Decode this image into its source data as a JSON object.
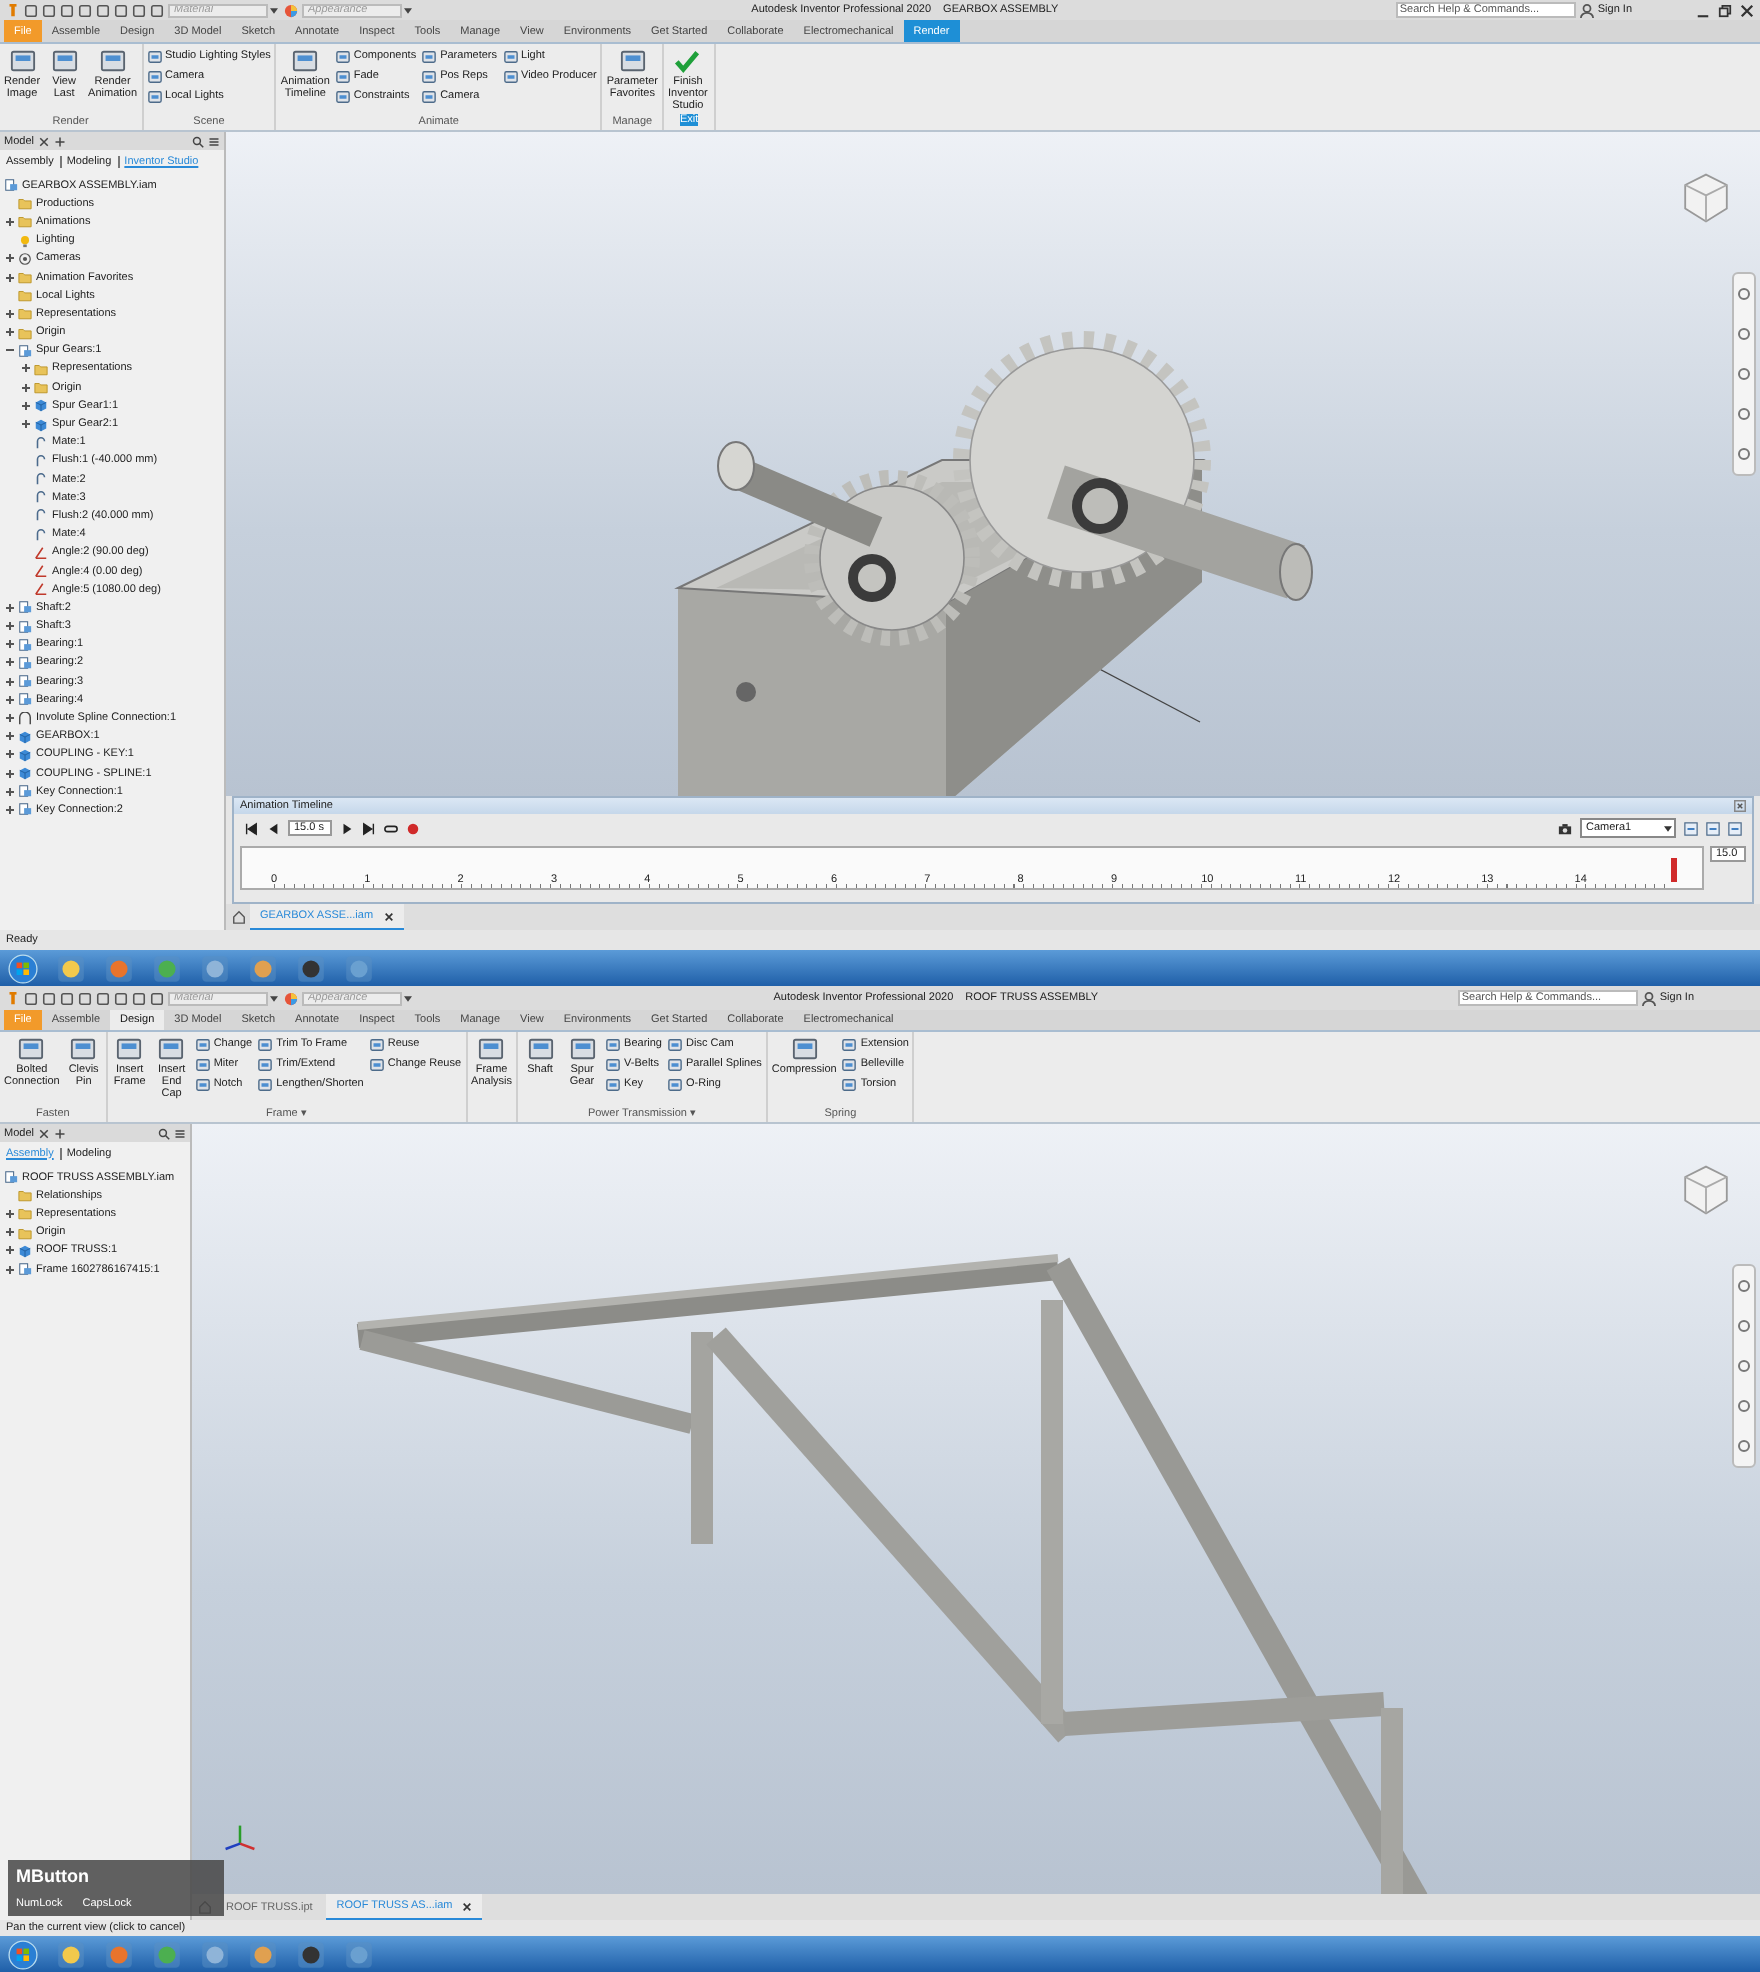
{
  "windows": [
    {
      "title": "Autodesk Inventor Professional 2020",
      "document": "GEARBOX ASSEMBLY",
      "material": {
        "placeholder": "Material"
      },
      "appearance": {
        "placeholder": "Appearance"
      },
      "search": {
        "placeholder": "Search Help & Commands..."
      },
      "sign_in": "Sign In",
      "window_controls": true,
      "tabs": [
        {
          "label": "File",
          "kind": "file",
          "selected": false
        },
        {
          "label": "Assemble",
          "kind": "tab",
          "selected": false
        },
        {
          "label": "Design",
          "kind": "tab",
          "selected": false
        },
        {
          "label": "3D Model",
          "kind": "tab",
          "selected": false
        },
        {
          "label": "Sketch",
          "kind": "tab",
          "selected": false
        },
        {
          "label": "Annotate",
          "kind": "tab",
          "selected": false
        },
        {
          "label": "Inspect",
          "kind": "tab",
          "selected": false
        },
        {
          "label": "Tools",
          "kind": "tab",
          "selected": false
        },
        {
          "label": "Manage",
          "kind": "tab",
          "selected": false
        },
        {
          "label": "View",
          "kind": "tab",
          "selected": false
        },
        {
          "label": "Environments",
          "kind": "tab",
          "selected": false
        },
        {
          "label": "Get Started",
          "kind": "tab",
          "selected": false
        },
        {
          "label": "Collaborate",
          "kind": "tab",
          "selected": false
        },
        {
          "label": "Electromechanical",
          "kind": "tab",
          "selected": false
        },
        {
          "label": "Render",
          "kind": "environment",
          "selected": true
        }
      ],
      "ribbon": [
        {
          "label": "Render",
          "items": [
            {
              "kind": "large",
              "label": "Render Image"
            },
            {
              "kind": "large",
              "label": "View Last"
            },
            {
              "kind": "large",
              "label": "Render Animation"
            }
          ]
        },
        {
          "label": "Scene",
          "items": [
            {
              "kind": "column",
              "items": [
                "Studio Lighting Styles",
                "Camera",
                "Local Lights"
              ]
            }
          ]
        },
        {
          "label": "Animate",
          "items": [
            {
              "kind": "large",
              "label": "Animation Timeline"
            },
            {
              "kind": "column",
              "items": [
                "Components",
                "Fade",
                "Constraints"
              ]
            },
            {
              "kind": "column",
              "items": [
                "Parameters",
                "Pos Reps",
                "Camera"
              ]
            },
            {
              "kind": "column",
              "items": [
                "Light",
                "Video Producer"
              ]
            }
          ]
        },
        {
          "label": "Manage",
          "items": [
            {
              "kind": "large",
              "label": "Parameter Favorites"
            }
          ]
        },
        {
          "label": "Exit",
          "accent": true,
          "items": [
            {
              "kind": "confirm",
              "label": "Finish Inventor Studio"
            }
          ]
        }
      ],
      "browser": {
        "title": "Model",
        "modes": [
          {
            "label": "Assembly",
            "selected": false
          },
          {
            "label": "Modeling",
            "selected": false
          },
          {
            "label": "Inventor Studio",
            "selected": true
          }
        ],
        "tree": [
          {
            "label": "GEARBOX ASSEMBLY.iam",
            "kind": "assembly",
            "children": [
              {
                "label": "Productions",
                "kind": "folder"
              },
              {
                "label": "Animations",
                "kind": "folder",
                "expanded": false
              },
              {
                "label": "Lighting",
                "kind": "light"
              },
              {
                "label": "Cameras",
                "kind": "camera",
                "expanded": false
              },
              {
                "label": "Animation Favorites",
                "kind": "folder",
                "expanded": false
              },
              {
                "label": "Local Lights",
                "kind": "folder"
              },
              {
                "label": "Representations",
                "kind": "folder",
                "expanded": false
              },
              {
                "label": "Origin",
                "kind": "folder",
                "expanded": false
              },
              {
                "label": "Spur Gears:1",
                "kind": "assembly",
                "expanded": true,
                "children": [
                  {
                    "label": "Representations",
                    "kind": "folder",
                    "expanded": false
                  },
                  {
                    "label": "Origin",
                    "kind": "folder",
                    "expanded": false
                  },
                  {
                    "label": "Spur Gear1:1",
                    "kind": "part",
                    "expanded": false
                  },
                  {
                    "label": "Spur Gear2:1",
                    "kind": "part",
                    "expanded": false
                  },
                  {
                    "label": "Mate:1",
                    "kind": "constraint"
                  },
                  {
                    "label": "Flush:1 (-40.000 mm)",
                    "kind": "constraint"
                  },
                  {
                    "label": "Mate:2",
                    "kind": "constraint"
                  },
                  {
                    "label": "Mate:3",
                    "kind": "constraint"
                  },
                  {
                    "label": "Flush:2 (40.000 mm)",
                    "kind": "constraint"
                  },
                  {
                    "label": "Mate:4",
                    "kind": "constraint"
                  },
                  {
                    "label": "Angle:2 (90.00 deg)",
                    "kind": "angle"
                  },
                  {
                    "label": "Angle:4 (0.00 deg)",
                    "kind": "angle"
                  },
                  {
                    "label": "Angle:5 (1080.00 deg)",
                    "kind": "angle"
                  }
                ]
              },
              {
                "label": "Shaft:2",
                "kind": "assembly",
                "expanded": false
              },
              {
                "label": "Shaft:3",
                "kind": "assembly",
                "expanded": false
              },
              {
                "label": "Bearing:1",
                "kind": "assembly",
                "expanded": false
              },
              {
                "label": "Bearing:2",
                "kind": "assembly",
                "expanded": false
              },
              {
                "label": "Bearing:3",
                "kind": "assembly",
                "expanded": false
              },
              {
                "label": "Bearing:4",
                "kind": "assembly",
                "expanded": false
              },
              {
                "label": "Involute Spline Connection:1",
                "kind": "spline",
                "expanded": false
              },
              {
                "label": "GEARBOX:1",
                "kind": "part",
                "expanded": false
              },
              {
                "label": "COUPLING - KEY:1",
                "kind": "part",
                "expanded": false
              },
              {
                "label": "COUPLING - SPLINE:1",
                "kind": "part",
                "expanded": false
              },
              {
                "label": "Key Connection:1",
                "kind": "assembly",
                "expanded": false
              },
              {
                "label": "Key Connection:2",
                "kind": "assembly",
                "expanded": false
              }
            ]
          }
        ]
      },
      "viewport": {
        "kind": "gearbox"
      },
      "timeline": {
        "title": "Animation Timeline",
        "time": "15.0 s",
        "camera": "Camera1",
        "end": "15.0",
        "ticks": [
          "0",
          "1",
          "2",
          "3",
          "4",
          "5",
          "6",
          "7",
          "8",
          "9",
          "10",
          "11",
          "12",
          "13",
          "14"
        ],
        "level": 1
      },
      "documents": [
        {
          "label": "GEARBOX ASSE...iam",
          "selected": true
        }
      ],
      "status": "Ready"
    },
    {
      "title": "Autodesk Inventor Professional 2020",
      "document": "ROOF TRUSS ASSEMBLY",
      "material": {
        "placeholder": "Material"
      },
      "appearance": {
        "placeholder": "Appearance"
      },
      "search": {
        "placeholder": "Search Help & Commands..."
      },
      "sign_in": "Sign In",
      "window_controls": false,
      "tabs": [
        {
          "label": "File",
          "kind": "file",
          "selected": false
        },
        {
          "label": "Assemble",
          "kind": "tab",
          "selected": false
        },
        {
          "label": "Design",
          "kind": "tab",
          "selected": true
        },
        {
          "label": "3D Model",
          "kind": "tab",
          "selected": false
        },
        {
          "label": "Sketch",
          "kind": "tab",
          "selected": false
        },
        {
          "label": "Annotate",
          "kind": "tab",
          "selected": false
        },
        {
          "label": "Inspect",
          "kind": "tab",
          "selected": false
        },
        {
          "label": "Tools",
          "kind": "tab",
          "selected": false
        },
        {
          "label": "Manage",
          "kind": "tab",
          "selected": false
        },
        {
          "label": "View",
          "kind": "tab",
          "selected": false
        },
        {
          "label": "Environments",
          "kind": "tab",
          "selected": false
        },
        {
          "label": "Get Started",
          "kind": "tab",
          "selected": false
        },
        {
          "label": "Collaborate",
          "kind": "tab",
          "selected": false
        },
        {
          "label": "Electromechanical",
          "kind": "tab",
          "selected": false
        }
      ],
      "ribbon": [
        {
          "label": "Fasten",
          "items": [
            {
              "kind": "large",
              "label": "Bolted Connection"
            },
            {
              "kind": "large",
              "label": "Clevis Pin"
            }
          ]
        },
        {
          "label": "Frame ▾",
          "items": [
            {
              "kind": "large",
              "label": "Insert Frame"
            },
            {
              "kind": "large",
              "label": "Insert End Cap"
            },
            {
              "kind": "column",
              "items": [
                "Change",
                "Miter",
                "Notch"
              ]
            },
            {
              "kind": "column",
              "items": [
                "Trim To Frame",
                "Trim/Extend",
                "Lengthen/Shorten"
              ]
            },
            {
              "kind": "column",
              "items": [
                "Reuse",
                "Change Reuse"
              ]
            }
          ]
        },
        {
          "items": [
            {
              "kind": "large",
              "label": "Frame Analysis"
            }
          ]
        },
        {
          "label": "Power Transmission ▾",
          "items": [
            {
              "kind": "large",
              "label": "Shaft"
            },
            {
              "kind": "large",
              "label": "Spur Gear"
            },
            {
              "kind": "column",
              "items": [
                "Bearing",
                "V-Belts",
                "Key"
              ]
            },
            {
              "kind": "column",
              "items": [
                "Disc Cam",
                "Parallel Splines",
                "O-Ring"
              ]
            }
          ]
        },
        {
          "label": "Spring",
          "items": [
            {
              "kind": "large",
              "label": "Compression"
            },
            {
              "kind": "column",
              "items": [
                "Extension",
                "Belleville",
                "Torsion"
              ]
            }
          ]
        }
      ],
      "browser": {
        "title": "Model",
        "modes": [
          {
            "label": "Assembly",
            "selected": true
          },
          {
            "label": "Modeling",
            "selected": false
          }
        ],
        "tree": [
          {
            "label": "ROOF TRUSS ASSEMBLY.iam",
            "kind": "assembly",
            "children": [
              {
                "label": "Relationships",
                "kind": "folder"
              },
              {
                "label": "Representations",
                "kind": "folder",
                "expanded": false
              },
              {
                "label": "Origin",
                "kind": "folder",
                "expanded": false
              },
              {
                "label": "ROOF TRUSS:1",
                "kind": "part",
                "expanded": false
              },
              {
                "label": "Frame 1602786167415:1",
                "kind": "assembly",
                "expanded": false
              }
            ]
          }
        ]
      },
      "viewport": {
        "kind": "truss"
      },
      "documents": [
        {
          "label": "ROOF TRUSS.ipt",
          "selected": false
        },
        {
          "label": "ROOF TRUSS AS...iam",
          "selected": true
        }
      ],
      "status": "Pan the current view (click to cancel)"
    }
  ],
  "key_overlay": {
    "title": "MButton",
    "keys": [
      "NumLock",
      "CapsLock"
    ]
  }
}
